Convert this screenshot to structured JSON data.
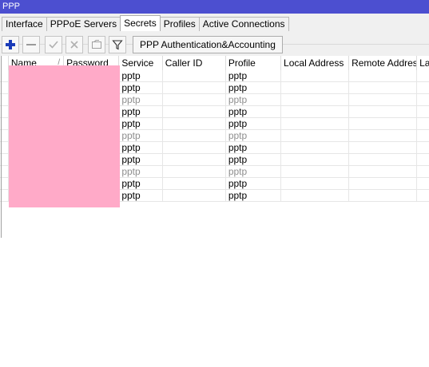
{
  "window": {
    "title": "PPP"
  },
  "tabs": [
    {
      "label": "Interface",
      "active": false
    },
    {
      "label": "PPPoE Servers",
      "active": false
    },
    {
      "label": "Secrets",
      "active": true
    },
    {
      "label": "Profiles",
      "active": false
    },
    {
      "label": "Active Connections",
      "active": false
    }
  ],
  "toolbar": {
    "icons": [
      "add-icon",
      "remove-icon",
      "enable-icon",
      "disable-icon",
      "comment-icon",
      "filter-icon"
    ],
    "aa_label": "PPP Authentication&Accounting"
  },
  "colors": {
    "titlebar": "#4c4fd0",
    "add_blue": "#1a3bb8",
    "redaction": "#ffaac8",
    "disabled_text": "#8e8e8e"
  },
  "table": {
    "columns": [
      "Name",
      "Password",
      "Service",
      "Caller ID",
      "Profile",
      "Local Address",
      "Remote Address",
      "La"
    ],
    "sort_indicator": "/",
    "rows": [
      {
        "service": "pptp",
        "profile": "pptp",
        "disabled": false
      },
      {
        "service": "pptp",
        "profile": "pptp",
        "disabled": false
      },
      {
        "service": "pptp",
        "profile": "pptp",
        "disabled": true
      },
      {
        "service": "pptp",
        "profile": "pptp",
        "disabled": false
      },
      {
        "service": "pptp",
        "profile": "pptp",
        "disabled": false
      },
      {
        "service": "pptp",
        "profile": "pptp",
        "disabled": true
      },
      {
        "service": "pptp",
        "profile": "pptp",
        "disabled": false
      },
      {
        "service": "pptp",
        "profile": "pptp",
        "disabled": false
      },
      {
        "service": "pptp",
        "profile": "pptp",
        "disabled": true
      },
      {
        "service": "pptp",
        "profile": "pptp",
        "disabled": false
      },
      {
        "service": "pptp",
        "profile": "pptp",
        "disabled": false
      }
    ]
  }
}
